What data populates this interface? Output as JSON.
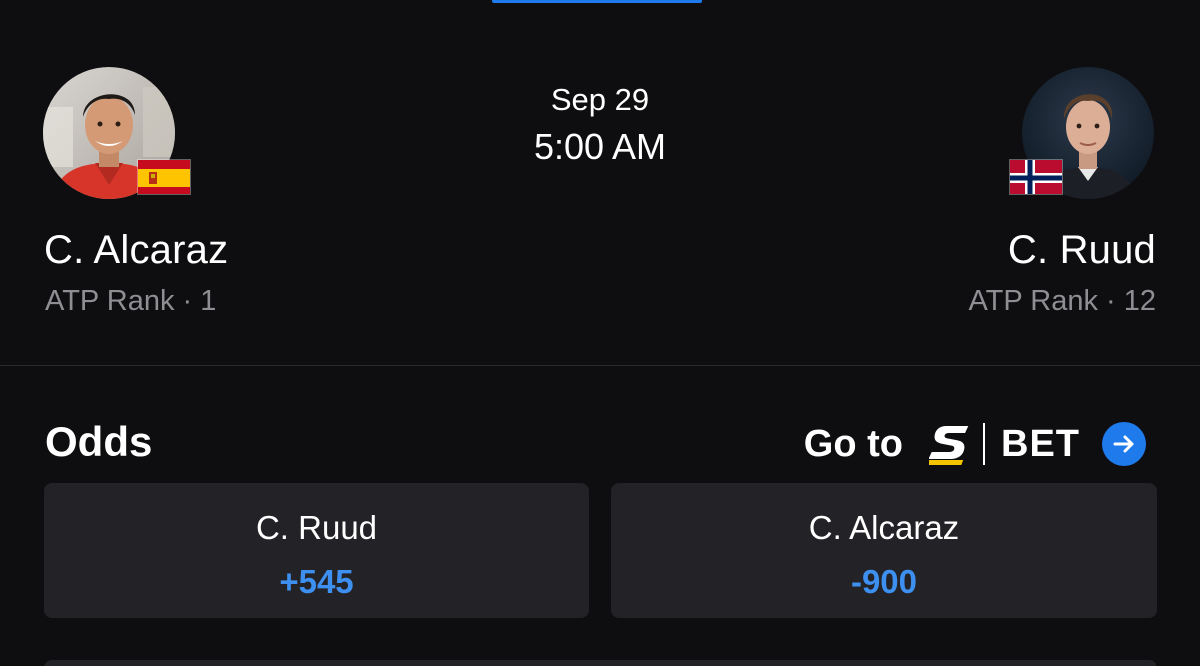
{
  "match": {
    "date": "Sep 29",
    "time": "5:00 AM"
  },
  "players": {
    "left": {
      "name": "C. Alcaraz",
      "rank": "ATP Rank · 1",
      "flag": "spain-flag",
      "avatar": "player-photo"
    },
    "right": {
      "name": "C. Ruud",
      "rank": "ATP Rank · 12",
      "flag": "norway-flag",
      "avatar": "player-photo"
    }
  },
  "odds": {
    "title": "Odds",
    "goto_label": "Go to",
    "brand_bet": "BET",
    "cards": [
      {
        "name": "C. Ruud",
        "value": "+545"
      },
      {
        "name": "C. Alcaraz",
        "value": "-900"
      }
    ]
  },
  "colors": {
    "background": "#0e0e10",
    "card": "#232327",
    "accent": "#1f7aec",
    "odds_text": "#3d8ff0",
    "muted_text": "#8e8e93"
  },
  "icons": {
    "arrow": "arrow-right-circle-icon",
    "brand_logo": "s-logo-icon"
  }
}
